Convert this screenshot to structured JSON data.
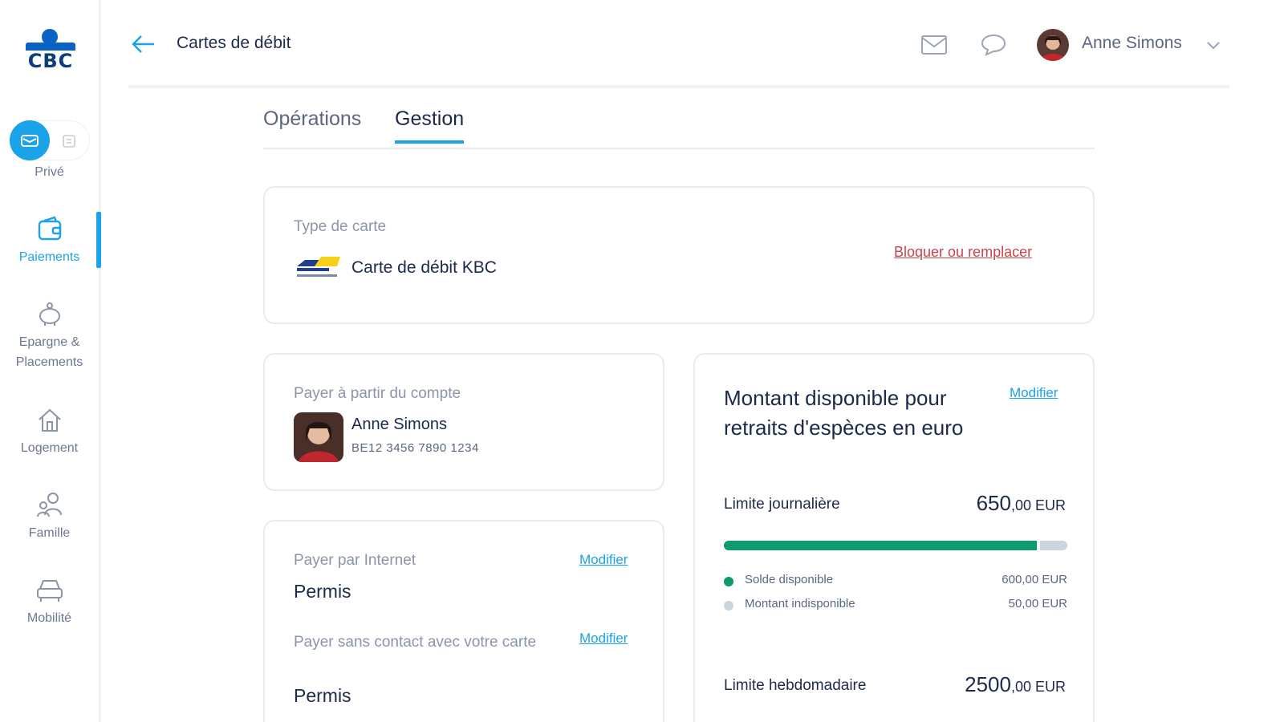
{
  "sidebar": {
    "logo_text": "CBC",
    "segment_label": "Privé",
    "items": [
      {
        "label": "Paiements"
      },
      {
        "label": "Epargne & Placements"
      },
      {
        "label": "Logement"
      },
      {
        "label": "Famille"
      },
      {
        "label": "Mobilité"
      }
    ]
  },
  "header": {
    "title": "Cartes de débit",
    "user_name": "Anne Simons"
  },
  "tabs": [
    {
      "label": "Opérations",
      "active": false
    },
    {
      "label": "Gestion",
      "active": true
    }
  ],
  "card_type": {
    "label": "Type de carte",
    "name": "Carte de débit KBC",
    "action": "Bloquer ou remplacer"
  },
  "account": {
    "label": "Payer à partir du compte",
    "holder": "Anne Simons",
    "iban": "BE12 3456 7890 1234"
  },
  "internet": {
    "internet_label": "Payer par Internet",
    "internet_value": "Permis",
    "internet_link": "Modifier",
    "contactless_label": "Payer sans contact avec votre carte",
    "contactless_value": "Permis",
    "contactless_link": "Modifier"
  },
  "amount": {
    "title": "Montant disponible pour retraits d'espèces en euro",
    "link": "Modifier",
    "daily_label": "Limite journalière",
    "daily_int": "650",
    "daily_dec": ",00 EUR",
    "available_fraction": 0.92,
    "available_label": "Solde disponible",
    "available_value": "600,00 EUR",
    "unavailable_label": "Montant indisponible",
    "unavailable_value": "50,00 EUR",
    "weekly_label": "Limite hebdomadaire",
    "weekly_int": "2500",
    "weekly_dec": ",00 EUR"
  },
  "colors": {
    "accent": "#1aa3e8",
    "available": "#0e9a6e",
    "unavailable": "#ccd4de",
    "danger": "#c8444b"
  }
}
